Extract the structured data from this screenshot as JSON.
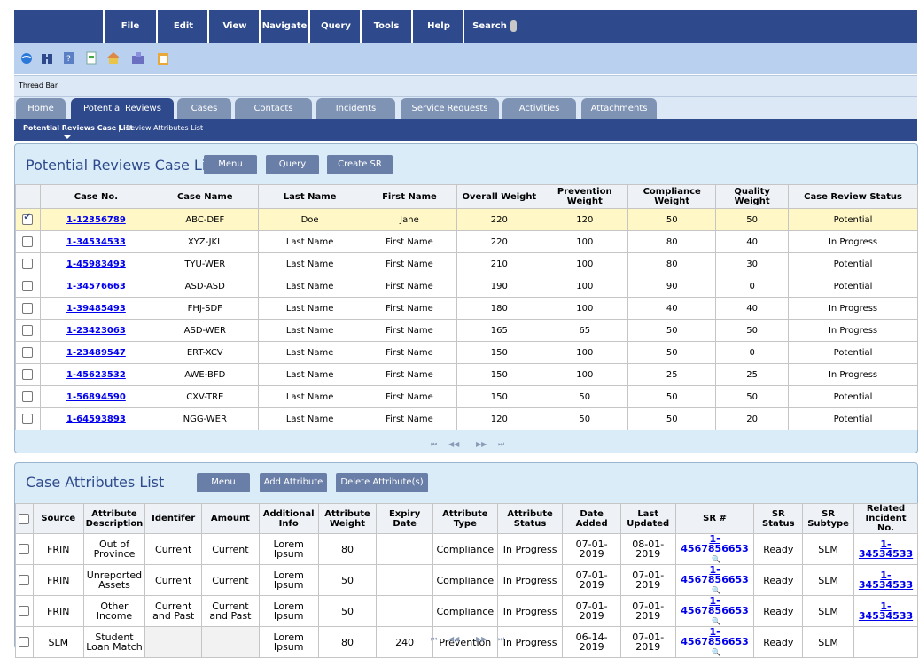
{
  "menu": {
    "items": [
      "File",
      "Edit",
      "View",
      "Navigate",
      "Query",
      "Tools",
      "Help"
    ],
    "search_label": "Search"
  },
  "toolbar_icons": [
    "globe-icon",
    "binoculars-icon",
    "help-book-icon",
    "document-icon",
    "home-icon",
    "organization-icon",
    "clipboard-icon"
  ],
  "thread_bar": "Thread Bar",
  "tabs": [
    {
      "label": "Home",
      "active": false
    },
    {
      "label": "Potential Reviews",
      "active": true
    },
    {
      "label": "Cases",
      "active": false
    },
    {
      "label": "Contacts",
      "active": false
    },
    {
      "label": "Incidents",
      "active": false
    },
    {
      "label": "Service Requests",
      "active": false
    },
    {
      "label": "Activities",
      "active": false
    },
    {
      "label": "Attachments",
      "active": false
    }
  ],
  "subnav": {
    "item1": "Potential Reviews Case List",
    "separator": "|",
    "item2": "Review Attributes List"
  },
  "cases": {
    "title": "Potential Reviews Case List",
    "buttons": {
      "menu": "Menu",
      "query": "Query",
      "create_sr": "Create SR"
    },
    "columns": [
      "Case No.",
      "Case Name",
      "Last Name",
      "First Name",
      "Overall Weight",
      "Prevention Weight",
      "Compliance Weight",
      "Quality Weight",
      "Case Review Status"
    ],
    "rows": [
      {
        "checked": true,
        "case_no": "1-12356789",
        "case_name": "ABC-DEF",
        "last": "Doe",
        "first": "Jane",
        "overall": "220",
        "prevention": "120",
        "compliance": "50",
        "quality": "50",
        "status": "Potential"
      },
      {
        "checked": false,
        "case_no": "1-34534533",
        "case_name": "XYZ-JKL",
        "last": "Last Name",
        "first": "First Name",
        "overall": "220",
        "prevention": "100",
        "compliance": "80",
        "quality": "40",
        "status": "In Progress"
      },
      {
        "checked": false,
        "case_no": "1-45983493",
        "case_name": "TYU-WER",
        "last": "Last Name",
        "first": "First Name",
        "overall": "210",
        "prevention": "100",
        "compliance": "80",
        "quality": "30",
        "status": "Potential"
      },
      {
        "checked": false,
        "case_no": "1-34576663",
        "case_name": "ASD-ASD",
        "last": "Last Name",
        "first": "First Name",
        "overall": "190",
        "prevention": "100",
        "compliance": "90",
        "quality": "0",
        "status": "Potential"
      },
      {
        "checked": false,
        "case_no": "1-39485493",
        "case_name": "FHJ-SDF",
        "last": "Last Name",
        "first": "First Name",
        "overall": "180",
        "prevention": "100",
        "compliance": "40",
        "quality": "40",
        "status": "In Progress"
      },
      {
        "checked": false,
        "case_no": "1-23423063",
        "case_name": "ASD-WER",
        "last": "Last Name",
        "first": "First Name",
        "overall": "165",
        "prevention": "65",
        "compliance": "50",
        "quality": "50",
        "status": "In Progress"
      },
      {
        "checked": false,
        "case_no": "1-23489547",
        "case_name": "ERT-XCV",
        "last": "Last Name",
        "first": "First Name",
        "overall": "150",
        "prevention": "100",
        "compliance": "50",
        "quality": "0",
        "status": "Potential"
      },
      {
        "checked": false,
        "case_no": "1-45623532",
        "case_name": "AWE-BFD",
        "last": "Last Name",
        "first": "First Name",
        "overall": "150",
        "prevention": "100",
        "compliance": "25",
        "quality": "25",
        "status": "In Progress"
      },
      {
        "checked": false,
        "case_no": "1-56894590",
        "case_name": "CXV-TRE",
        "last": "Last Name",
        "first": "First Name",
        "overall": "150",
        "prevention": "50",
        "compliance": "50",
        "quality": "50",
        "status": "Potential"
      },
      {
        "checked": false,
        "case_no": "1-64593893",
        "case_name": "NGG-WER",
        "last": "Last Name",
        "first": "First Name",
        "overall": "120",
        "prevention": "50",
        "compliance": "50",
        "quality": "20",
        "status": "Potential"
      }
    ],
    "pager": {
      "first": "⏮",
      "prev": "◀◀",
      "next": "▶▶",
      "last": "⏭"
    }
  },
  "attributes": {
    "title": "Case Attributes List",
    "buttons": {
      "menu": "Menu",
      "add": "Add Attribute",
      "delete": "Delete Attribute(s)"
    },
    "columns": [
      "Source",
      "Attribute Description",
      "Identifer",
      "Amount",
      "Additional Info",
      "Attribute Weight",
      "Expiry Date",
      "Attribute Type",
      "Attribute Status",
      "Date Added",
      "Last Updated",
      "SR #",
      "SR Status",
      "SR Subtype",
      "Related Incident No."
    ],
    "rows": [
      {
        "source": "FRIN",
        "desc": "Out of Province",
        "ident": "Current",
        "amount": "Current",
        "info": "Lorem Ipsum",
        "weight": "80",
        "expiry": "",
        "type": "Compliance",
        "status": "In Progress",
        "added": "07-01-2019",
        "updated": "08-01-2019",
        "sr": "1-4567856653",
        "sr_status": "Ready",
        "subtype": "SLM",
        "incident": "1-34534533"
      },
      {
        "source": "FRIN",
        "desc": "Unreported Assets",
        "ident": "Current",
        "amount": "Current",
        "info": "Lorem Ipsum",
        "weight": "50",
        "expiry": "",
        "type": "Compliance",
        "status": "In Progress",
        "added": "07-01-2019",
        "updated": "07-01-2019",
        "sr": "1-4567856653",
        "sr_status": "Ready",
        "subtype": "SLM",
        "incident": "1-34534533"
      },
      {
        "source": "FRIN",
        "desc": "Other Income",
        "ident": "Current and Past",
        "amount": "Current and Past",
        "info": "Lorem Ipsum",
        "weight": "50",
        "expiry": "",
        "type": "Compliance",
        "status": "In Progress",
        "added": "07-01-2019",
        "updated": "07-01-2019",
        "sr": "1-4567856653",
        "sr_status": "Ready",
        "subtype": "SLM",
        "incident": "1-34534533"
      },
      {
        "source": "SLM",
        "desc": "Student Loan Match",
        "ident": "",
        "amount": "",
        "info": "Lorem Ipsum",
        "weight": "80",
        "expiry": "240",
        "type": "Prevention",
        "status": "In Progress",
        "added": "06-14-2019",
        "updated": "07-01-2019",
        "sr": "1-4567856653",
        "sr_status": "Ready",
        "subtype": "SLM",
        "incident": ""
      }
    ],
    "pager": {
      "first": "⏮",
      "prev": "◀◀",
      "next": "▶▶",
      "last": "⏭"
    }
  }
}
